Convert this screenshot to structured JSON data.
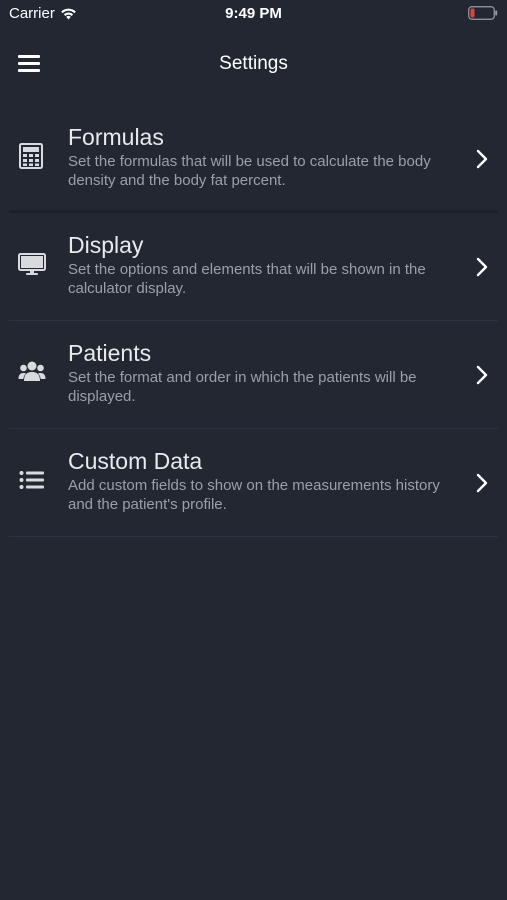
{
  "status_bar": {
    "carrier": "Carrier",
    "time": "9:49 PM",
    "battery_color": "#e0453a"
  },
  "nav": {
    "title": "Settings",
    "menu_icon": "hamburger-menu-icon"
  },
  "settings": [
    {
      "icon": "calculator-icon",
      "title": "Formulas",
      "description": "Set the formulas that will be used to calculate the body density and the body fat percent."
    },
    {
      "icon": "monitor-icon",
      "title": "Display",
      "description": "Set the options and elements that will be shown in the calculator display."
    },
    {
      "icon": "users-icon",
      "title": "Patients",
      "description": "Set the format and order in which the patients will be displayed."
    },
    {
      "icon": "list-icon",
      "title": "Custom Data",
      "description": "Add custom fields to show on the measurements history and the patient's profile."
    }
  ],
  "colors": {
    "background": "#222731",
    "title_text": "#e9eaec",
    "description_text": "#9aa0a8"
  }
}
